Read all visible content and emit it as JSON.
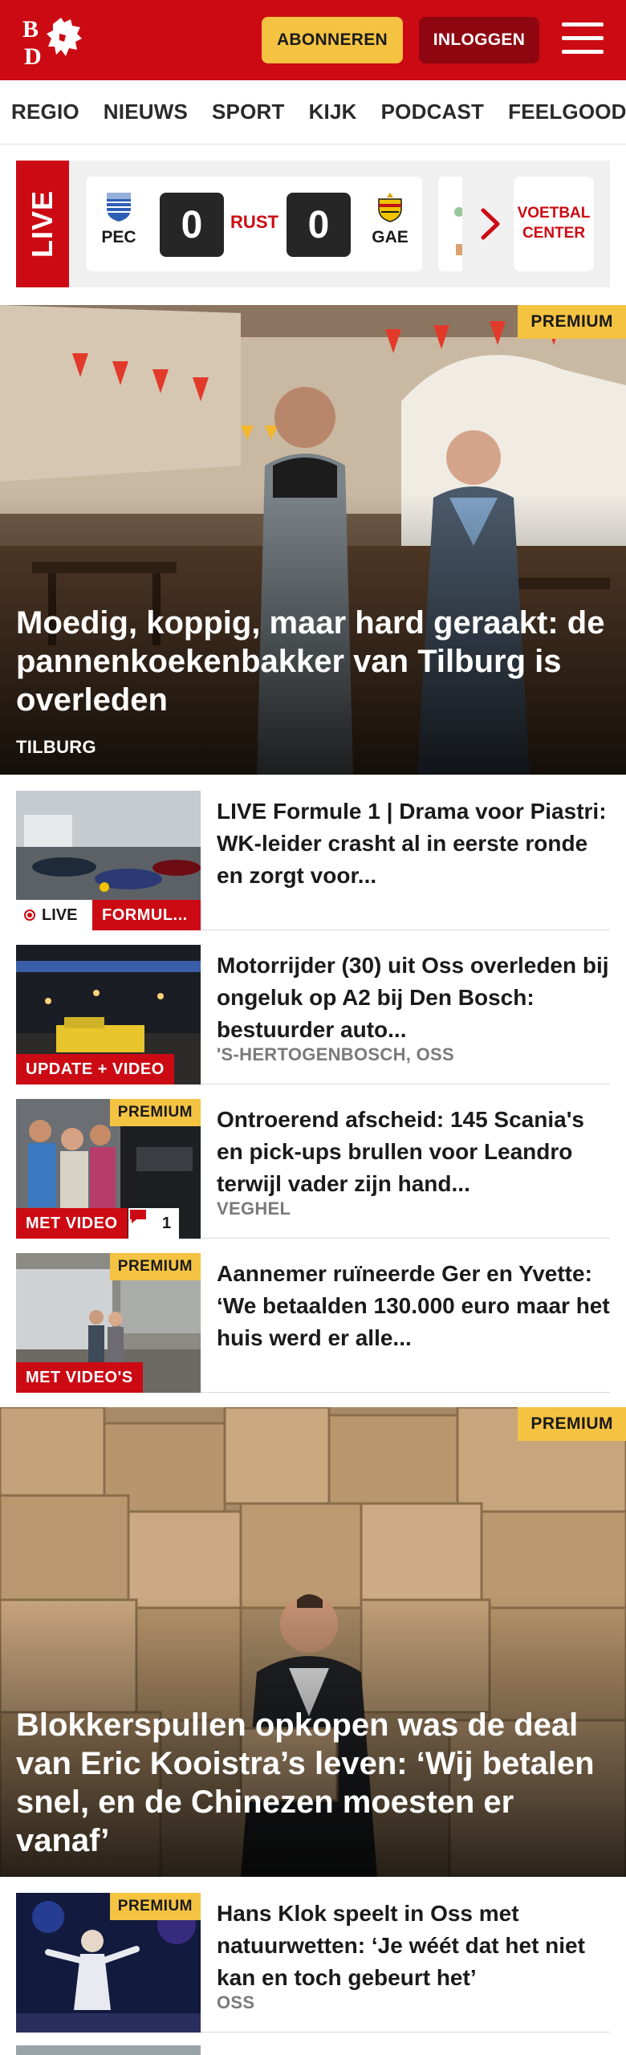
{
  "header": {
    "logo_text": "BD",
    "subscribe_label": "ABONNEREN",
    "login_label": "INLOGGEN",
    "menu_icon": "hamburger-menu-icon",
    "brand_color": "#cc0a14"
  },
  "nav": {
    "items": [
      "REGIO",
      "NIEUWS",
      "SPORT",
      "KIJK",
      "PODCAST",
      "FEELGOOD"
    ]
  },
  "live": {
    "tag": "LIVE",
    "home_abbr": "PEC",
    "home_score": "0",
    "status": "RUST",
    "away_score": "0",
    "away_abbr": "GAE",
    "next_icon": "chevron-right-icon",
    "voetbal_center": "VOETBAL CENTER"
  },
  "hero1": {
    "badge": "PREMIUM",
    "title": "Moedig, koppig, maar hard geraakt: de pannenkoekenbakker van Tilburg is overleden",
    "location": "TILBURG"
  },
  "articles": [
    {
      "title": "LIVE Formule 1 | Drama voor Piastri: WK-leider crasht al in eerste ronde en zorgt voor...",
      "live_label": "LIVE",
      "tag": "FORMUL..."
    },
    {
      "title": "Motorrijder (30) uit Oss overleden bij ongeluk op A2 bij Den Bosch: bestuurder auto...",
      "location": "'S-HERTOGENBOSCH, OSS",
      "tag": "UPDATE + VIDEO"
    },
    {
      "title": "Ontroerend afscheid: 145 Scania's en pick-ups brullen voor Leandro terwijl vader zijn hand...",
      "location": "VEGHEL",
      "badge": "PREMIUM",
      "tag": "MET VIDEO",
      "comments": "1"
    },
    {
      "title": "Aannemer ruïneerde Ger en Yvette: ‘We betaalden 130.000 euro maar het huis werd er alle...",
      "badge": "PREMIUM",
      "tag": "MET VIDEO'S"
    }
  ],
  "hero2": {
    "badge": "PREMIUM",
    "title": "Blokkerspullen opkopen was de deal van Eric Kooistra’s leven: ‘Wij betalen snel, en de Chinezen moesten er vanaf’"
  },
  "article5": {
    "title": "Hans Klok speelt in Oss met natuurwetten: ‘Je wéét dat het niet kan en toch gebeurt het’",
    "location": "OSS",
    "badge": "PREMIUM"
  }
}
